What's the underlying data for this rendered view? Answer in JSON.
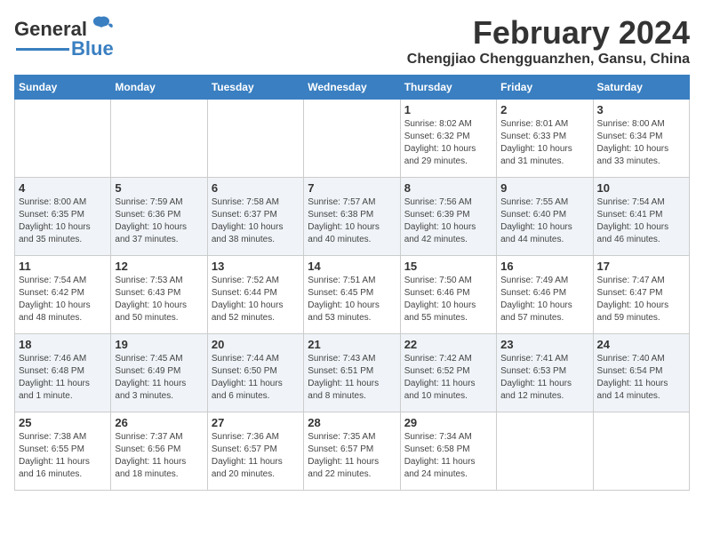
{
  "header": {
    "logo_line1": "General",
    "logo_line2": "Blue",
    "title": "February 2024",
    "subtitle": "Chengjiao Chengguanzhen, Gansu, China"
  },
  "weekdays": [
    "Sunday",
    "Monday",
    "Tuesday",
    "Wednesday",
    "Thursday",
    "Friday",
    "Saturday"
  ],
  "weeks": [
    [
      {
        "day": "",
        "info": ""
      },
      {
        "day": "",
        "info": ""
      },
      {
        "day": "",
        "info": ""
      },
      {
        "day": "",
        "info": ""
      },
      {
        "day": "1",
        "info": "Sunrise: 8:02 AM\nSunset: 6:32 PM\nDaylight: 10 hours\nand 29 minutes."
      },
      {
        "day": "2",
        "info": "Sunrise: 8:01 AM\nSunset: 6:33 PM\nDaylight: 10 hours\nand 31 minutes."
      },
      {
        "day": "3",
        "info": "Sunrise: 8:00 AM\nSunset: 6:34 PM\nDaylight: 10 hours\nand 33 minutes."
      }
    ],
    [
      {
        "day": "4",
        "info": "Sunrise: 8:00 AM\nSunset: 6:35 PM\nDaylight: 10 hours\nand 35 minutes."
      },
      {
        "day": "5",
        "info": "Sunrise: 7:59 AM\nSunset: 6:36 PM\nDaylight: 10 hours\nand 37 minutes."
      },
      {
        "day": "6",
        "info": "Sunrise: 7:58 AM\nSunset: 6:37 PM\nDaylight: 10 hours\nand 38 minutes."
      },
      {
        "day": "7",
        "info": "Sunrise: 7:57 AM\nSunset: 6:38 PM\nDaylight: 10 hours\nand 40 minutes."
      },
      {
        "day": "8",
        "info": "Sunrise: 7:56 AM\nSunset: 6:39 PM\nDaylight: 10 hours\nand 42 minutes."
      },
      {
        "day": "9",
        "info": "Sunrise: 7:55 AM\nSunset: 6:40 PM\nDaylight: 10 hours\nand 44 minutes."
      },
      {
        "day": "10",
        "info": "Sunrise: 7:54 AM\nSunset: 6:41 PM\nDaylight: 10 hours\nand 46 minutes."
      }
    ],
    [
      {
        "day": "11",
        "info": "Sunrise: 7:54 AM\nSunset: 6:42 PM\nDaylight: 10 hours\nand 48 minutes."
      },
      {
        "day": "12",
        "info": "Sunrise: 7:53 AM\nSunset: 6:43 PM\nDaylight: 10 hours\nand 50 minutes."
      },
      {
        "day": "13",
        "info": "Sunrise: 7:52 AM\nSunset: 6:44 PM\nDaylight: 10 hours\nand 52 minutes."
      },
      {
        "day": "14",
        "info": "Sunrise: 7:51 AM\nSunset: 6:45 PM\nDaylight: 10 hours\nand 53 minutes."
      },
      {
        "day": "15",
        "info": "Sunrise: 7:50 AM\nSunset: 6:46 PM\nDaylight: 10 hours\nand 55 minutes."
      },
      {
        "day": "16",
        "info": "Sunrise: 7:49 AM\nSunset: 6:46 PM\nDaylight: 10 hours\nand 57 minutes."
      },
      {
        "day": "17",
        "info": "Sunrise: 7:47 AM\nSunset: 6:47 PM\nDaylight: 10 hours\nand 59 minutes."
      }
    ],
    [
      {
        "day": "18",
        "info": "Sunrise: 7:46 AM\nSunset: 6:48 PM\nDaylight: 11 hours\nand 1 minute."
      },
      {
        "day": "19",
        "info": "Sunrise: 7:45 AM\nSunset: 6:49 PM\nDaylight: 11 hours\nand 3 minutes."
      },
      {
        "day": "20",
        "info": "Sunrise: 7:44 AM\nSunset: 6:50 PM\nDaylight: 11 hours\nand 6 minutes."
      },
      {
        "day": "21",
        "info": "Sunrise: 7:43 AM\nSunset: 6:51 PM\nDaylight: 11 hours\nand 8 minutes."
      },
      {
        "day": "22",
        "info": "Sunrise: 7:42 AM\nSunset: 6:52 PM\nDaylight: 11 hours\nand 10 minutes."
      },
      {
        "day": "23",
        "info": "Sunrise: 7:41 AM\nSunset: 6:53 PM\nDaylight: 11 hours\nand 12 minutes."
      },
      {
        "day": "24",
        "info": "Sunrise: 7:40 AM\nSunset: 6:54 PM\nDaylight: 11 hours\nand 14 minutes."
      }
    ],
    [
      {
        "day": "25",
        "info": "Sunrise: 7:38 AM\nSunset: 6:55 PM\nDaylight: 11 hours\nand 16 minutes."
      },
      {
        "day": "26",
        "info": "Sunrise: 7:37 AM\nSunset: 6:56 PM\nDaylight: 11 hours\nand 18 minutes."
      },
      {
        "day": "27",
        "info": "Sunrise: 7:36 AM\nSunset: 6:57 PM\nDaylight: 11 hours\nand 20 minutes."
      },
      {
        "day": "28",
        "info": "Sunrise: 7:35 AM\nSunset: 6:57 PM\nDaylight: 11 hours\nand 22 minutes."
      },
      {
        "day": "29",
        "info": "Sunrise: 7:34 AM\nSunset: 6:58 PM\nDaylight: 11 hours\nand 24 minutes."
      },
      {
        "day": "",
        "info": ""
      },
      {
        "day": "",
        "info": ""
      }
    ]
  ]
}
